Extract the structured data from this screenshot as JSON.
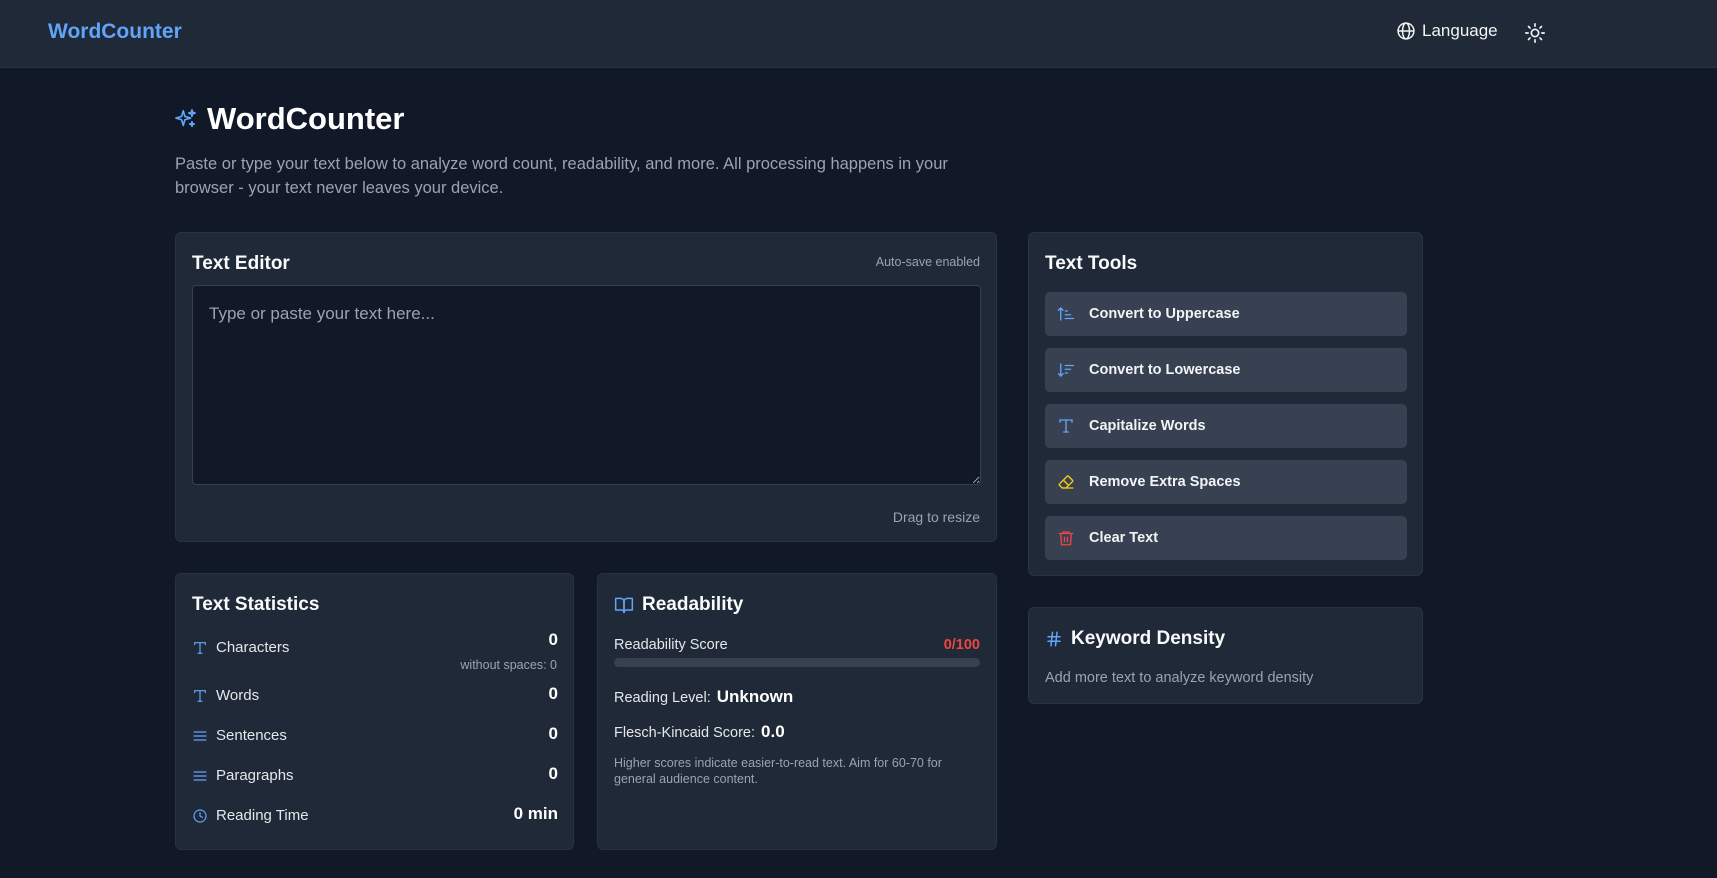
{
  "app": {
    "brand": "WordCounter"
  },
  "nav": {
    "language_label": "Language",
    "theme_icon": "sun-icon"
  },
  "hero": {
    "title": "WordCounter",
    "description": "Paste or type your text below to analyze word count, readability, and more. All processing happens in your browser - your text never leaves your device."
  },
  "editor": {
    "title": "Text Editor",
    "autosave": "Auto-save enabled",
    "placeholder": "Type or paste your text here...",
    "value": "",
    "resize_hint": "Drag to resize"
  },
  "tools": {
    "title": "Text Tools",
    "buttons": [
      {
        "label": "Convert to Uppercase",
        "icon": "sort-ascending-icon",
        "color": "#60a5fa"
      },
      {
        "label": "Convert to Lowercase",
        "icon": "sort-descending-icon",
        "color": "#60a5fa"
      },
      {
        "label": "Capitalize Words",
        "icon": "type-icon",
        "color": "#60a5fa"
      },
      {
        "label": "Remove Extra Spaces",
        "icon": "eraser-icon",
        "color": "#facc15"
      },
      {
        "label": "Clear Text",
        "icon": "trash-icon",
        "color": "#ef4444"
      }
    ]
  },
  "stats": {
    "title": "Text Statistics",
    "characters": {
      "label": "Characters",
      "value": "0",
      "sub": "without spaces: 0"
    },
    "words": {
      "label": "Words",
      "value": "0"
    },
    "sentences": {
      "label": "Sentences",
      "value": "0"
    },
    "paragraphs": {
      "label": "Paragraphs",
      "value": "0"
    },
    "reading_time": {
      "label": "Reading Time",
      "value": "0 min"
    }
  },
  "readability": {
    "title": "Readability",
    "score_label": "Readability Score",
    "score_text": "0/100",
    "score_fraction": 0,
    "level_label": "Reading Level:",
    "level_value": "Unknown",
    "fk_label": "Flesch-Kincaid Score:",
    "fk_value": "0.0",
    "note": "Higher scores indicate easier-to-read text. Aim for 60-70 for general audience content."
  },
  "keywords": {
    "title": "Keyword Density",
    "empty_note": "Add more text to analyze keyword density"
  },
  "colors": {
    "accent": "#60a5fa",
    "background": "#111827",
    "panel": "#1f2937",
    "danger": "#ef4444",
    "warning": "#facc15"
  }
}
